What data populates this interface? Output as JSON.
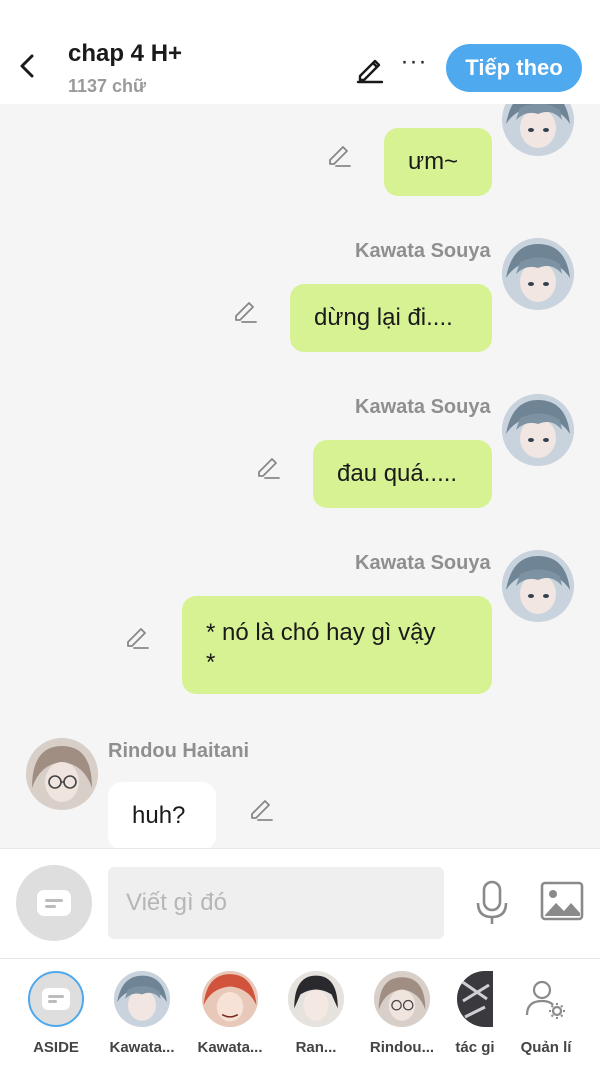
{
  "header": {
    "title": "chap 4 H+",
    "word_count": "1137 chữ",
    "next_label": "Tiếp theo",
    "more_label": "···"
  },
  "messages": [
    {
      "side": "right",
      "sender": "Kawata Souya",
      "text": "ưm~"
    },
    {
      "side": "right",
      "sender": "Kawata Souya",
      "text": "dừng lại đi...."
    },
    {
      "side": "right",
      "sender": "Kawata Souya",
      "text": "đau quá....."
    },
    {
      "side": "right",
      "sender": "Kawata Souya",
      "text_line1": "* nó là chó hay gì vậy",
      "text_line2": "*"
    },
    {
      "side": "left",
      "sender": "Rindou Haitani",
      "text": "huh?"
    }
  ],
  "composer": {
    "placeholder": "Viết gì đó"
  },
  "characters": [
    {
      "label": "ASIDE",
      "icon": "aside-icon"
    },
    {
      "label": "Kawata..."
    },
    {
      "label": "Kawata..."
    },
    {
      "label": "Ran..."
    },
    {
      "label": "Rindou..."
    },
    {
      "label": "tác gi"
    },
    {
      "label": "Quản lí",
      "icon": "user-settings-icon"
    }
  ],
  "colors": {
    "accent": "#4fa9ef",
    "right_bubble": "#d7f293",
    "left_bubble": "#ffffff",
    "background": "#f5f5f5"
  }
}
